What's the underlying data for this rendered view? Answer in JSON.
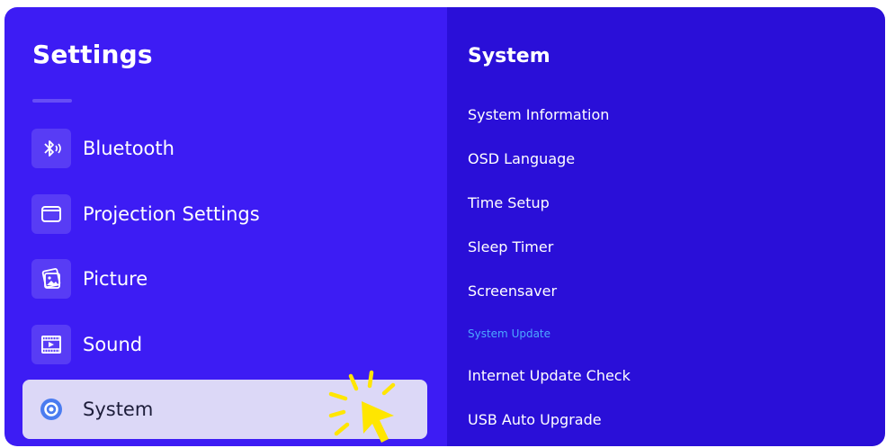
{
  "left_panel": {
    "title": "Settings",
    "items": [
      {
        "label": "Bluetooth",
        "icon": "bluetooth-icon"
      },
      {
        "label": "Projection Settings",
        "icon": "projection-icon"
      },
      {
        "label": "Picture",
        "icon": "picture-icon"
      },
      {
        "label": "Sound",
        "icon": "sound-icon"
      },
      {
        "label": "System",
        "icon": "gear-icon",
        "selected": true
      }
    ]
  },
  "right_panel": {
    "title": "System",
    "items": [
      {
        "label": "System Information"
      },
      {
        "label": "OSD Language"
      },
      {
        "label": "Time Setup"
      },
      {
        "label": "Sleep Timer"
      },
      {
        "label": "Screensaver"
      },
      {
        "label": "System Update",
        "active": true
      },
      {
        "label": "Internet Update Check"
      },
      {
        "label": "USB Auto Upgrade"
      }
    ]
  },
  "colors": {
    "left_bg": "#3d1cf4",
    "right_bg": "#2a0fd8",
    "selected_bg": "#dcd8f7",
    "active_text": "#4ca8ff",
    "cursor": "#ffe600"
  }
}
